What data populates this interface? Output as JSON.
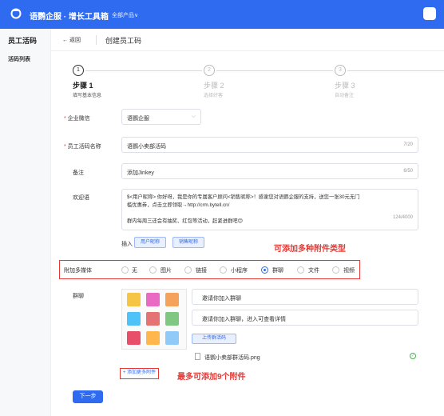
{
  "topbar": {
    "brand": "语鹦企服 · 增长工具箱",
    "all_products": "全部产品∨",
    "accent": "#2f6bf0"
  },
  "sidebar": {
    "title": "员工活码",
    "items": [
      {
        "label": "活码列表"
      }
    ]
  },
  "header": {
    "back": "← 返回",
    "title": "创建员工码"
  },
  "steps": [
    {
      "num": "1",
      "name": "步骤 1",
      "desc": "填写基本信息",
      "active": true
    },
    {
      "num": "2",
      "name": "步骤 2",
      "desc": "选择好客",
      "active": false
    },
    {
      "num": "3",
      "name": "步骤 3",
      "desc": "自动备注",
      "active": false
    }
  ],
  "form": {
    "wechat": {
      "label": "企业微信",
      "value": "语鹦企服"
    },
    "code_name": {
      "label": "员工活码名称",
      "value": "语鹦小卖部活码",
      "counter": "7/20"
    },
    "remark": {
      "label": "备注",
      "value": "添加Jinkey",
      "counter": "6/50"
    },
    "welcome": {
      "label": "欢迎语",
      "line1": "$<用户昵称> 你好呀，我是你的专属客户顾问<销售昵称>！感谢您对语鹦企服的支持，送您一张30元无门",
      "line2": "槛优惠券，点击立即领取→http://crm.bytell.cn/",
      "line3": "群内每周三还会有抽奖、红包等活动，赶紧进群吧😊",
      "counter": "124/4000"
    },
    "insert": {
      "label": "插入",
      "user_nick": "用户昵称",
      "sales_nick": "销售昵称"
    },
    "media": {
      "label": "附加多媒体",
      "options": [
        "无",
        "图片",
        "链接",
        "小程序",
        "群聊",
        "文件",
        "视频"
      ],
      "selected": "群聊"
    },
    "group": {
      "label": "群聊",
      "field1": "邀请你加入群聊",
      "field2": "邀请你加入群聊，进入可查看详情",
      "upload": "上传群活码",
      "file": "语鹦小卖部群活码.png"
    },
    "add_more": "+ 添加更多附件",
    "next": "下一步"
  },
  "annotations": {
    "media_types": "可添加多种附件类型",
    "max_attach": "最多可添加9个附件",
    "color": "#e53935"
  }
}
